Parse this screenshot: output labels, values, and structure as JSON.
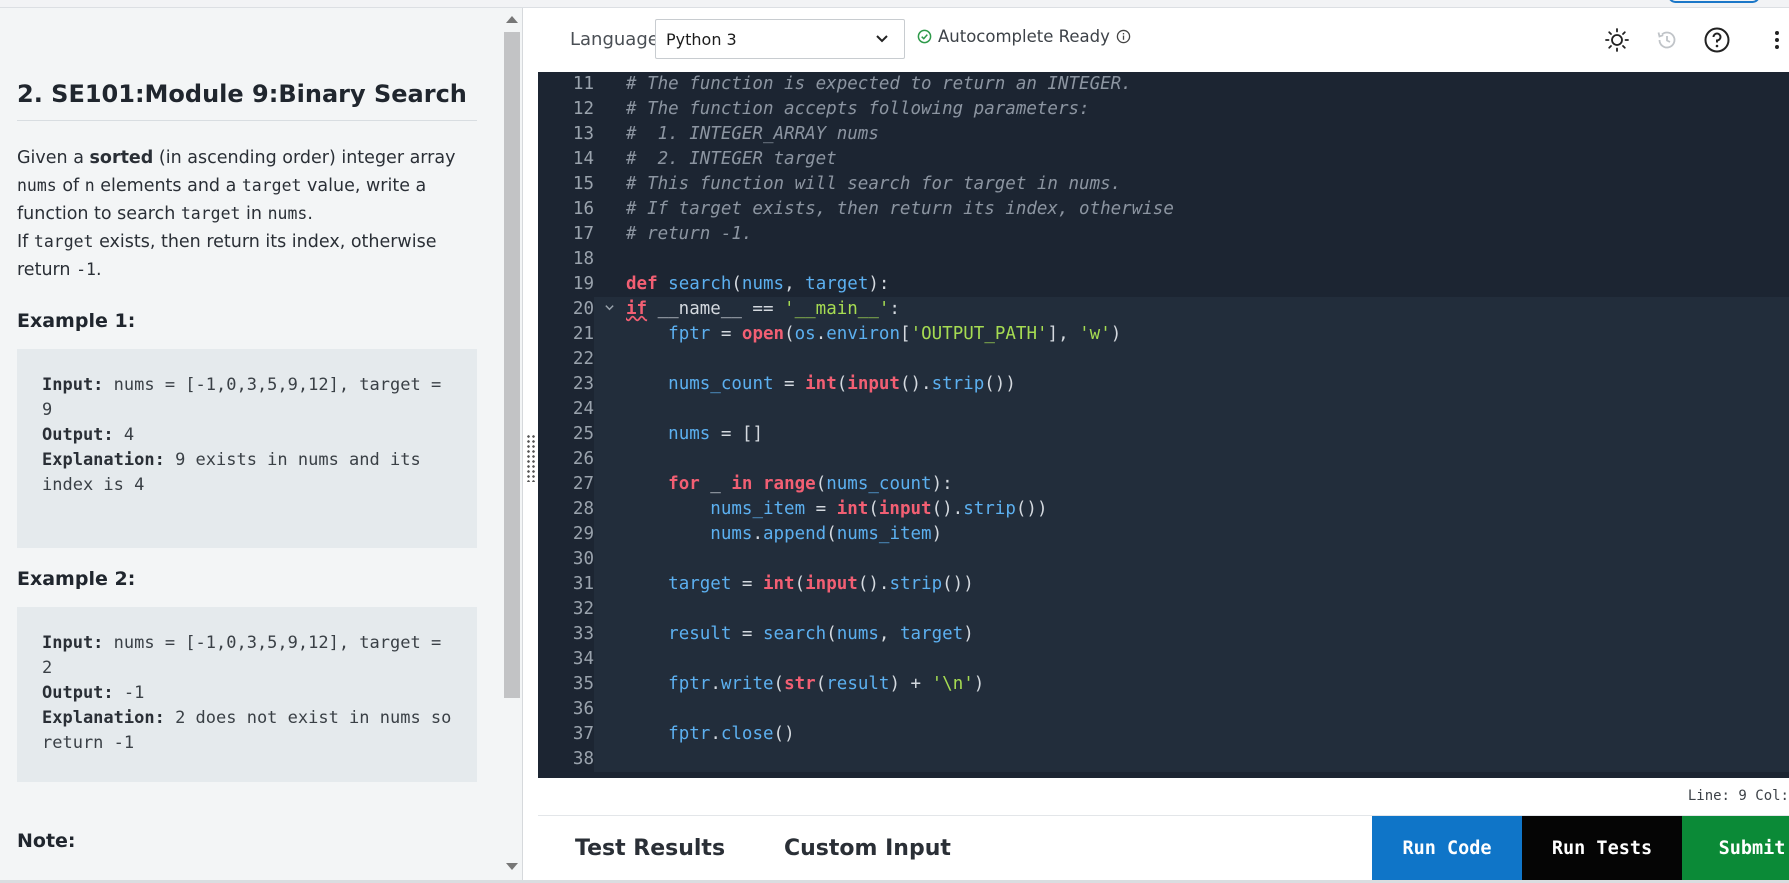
{
  "problem": {
    "title": "2. SE101:Module 9:Binary Search",
    "description": {
      "p1": "Given a ",
      "p1_bold": "sorted",
      "p2": " (in ascending order) integer array ",
      "p2_code": "nums",
      "p3": " of ",
      "p3_code": "n",
      "p4": " elements and a ",
      "p4_code": "target",
      "p5": " value, write a function to search ",
      "p5_code": "target",
      "p6": " in ",
      "p6_code": "nums",
      "p7": ".",
      "p8": "If ",
      "p8_code": "target",
      "p9": " exists, then return its index, otherwise return ",
      "p9_code": "-1",
      "p10": "."
    },
    "examples": [
      {
        "heading": "Example 1:",
        "input_label": "Input:",
        "input_value": " nums = [-1,0,3,5,9,12], target = 9",
        "output_label": "Output:",
        "output_value": " 4",
        "explanation_label": "Explanation:",
        "explanation_value": " 9 exists in nums and its index is 4"
      },
      {
        "heading": "Example 2:",
        "input_label": "Input:",
        "input_value": " nums = [-1,0,3,5,9,12], target = 2",
        "output_label": "Output:",
        "output_value": " -1",
        "explanation_label": "Explanation:",
        "explanation_value": " 2 does not exist in nums so return -1"
      }
    ],
    "note_heading": "Note:"
  },
  "toolbar": {
    "language_label": "Language",
    "language_value": "Python 3",
    "autocomplete_status": "Autocomplete Ready",
    "icons": [
      "sun-icon",
      "history-icon",
      "help-icon",
      "more-vertical-icon"
    ]
  },
  "editor": {
    "lines": [
      {
        "n": "11",
        "code": "# The function is expected to return an INTEGER."
      },
      {
        "n": "12",
        "code": "# The function accepts following parameters:"
      },
      {
        "n": "13",
        "code": "#  1. INTEGER_ARRAY nums"
      },
      {
        "n": "14",
        "code": "#  2. INTEGER target"
      },
      {
        "n": "15",
        "code": "# This function will search for target in nums."
      },
      {
        "n": "16",
        "code": "# If target exists, then return its index, otherwise"
      },
      {
        "n": "17",
        "code": "# return -1."
      },
      {
        "n": "18",
        "code": ""
      },
      {
        "n": "19",
        "code": "def search(nums, target):"
      },
      {
        "n": "20",
        "code": "if __name__ == '__main__':"
      },
      {
        "n": "21",
        "code": "    fptr = open(os.environ['OUTPUT_PATH'], 'w')"
      },
      {
        "n": "22",
        "code": ""
      },
      {
        "n": "23",
        "code": "    nums_count = int(input().strip())"
      },
      {
        "n": "24",
        "code": ""
      },
      {
        "n": "25",
        "code": "    nums = []"
      },
      {
        "n": "26",
        "code": ""
      },
      {
        "n": "27",
        "code": "    for _ in range(nums_count):"
      },
      {
        "n": "28",
        "code": "        nums_item = int(input().strip())"
      },
      {
        "n": "29",
        "code": "        nums.append(nums_item)"
      },
      {
        "n": "30",
        "code": ""
      },
      {
        "n": "31",
        "code": "    target = int(input().strip())"
      },
      {
        "n": "32",
        "code": ""
      },
      {
        "n": "33",
        "code": "    result = search(nums, target)"
      },
      {
        "n": "34",
        "code": ""
      },
      {
        "n": "35",
        "code": "    fptr.write(str(result) + '\\n')"
      },
      {
        "n": "36",
        "code": ""
      },
      {
        "n": "37",
        "code": "    fptr.close()"
      },
      {
        "n": "38",
        "code": ""
      }
    ],
    "fold_line": "20",
    "cursor_position": "Line: 9 Col:"
  },
  "bottom": {
    "tabs": [
      "Test Results",
      "Custom Input"
    ],
    "run_code_label": "Run Code",
    "run_tests_label": "Run Tests",
    "submit_label": "Submit"
  },
  "colors": {
    "run_code": "#0f75c8",
    "run_tests": "#050505",
    "submit": "#0b8a37",
    "editor_bg": "#1c2532",
    "keyword": "#f25f73",
    "function": "#5cb0f0",
    "string": "#a6dc52",
    "comment": "#8c95a1"
  }
}
